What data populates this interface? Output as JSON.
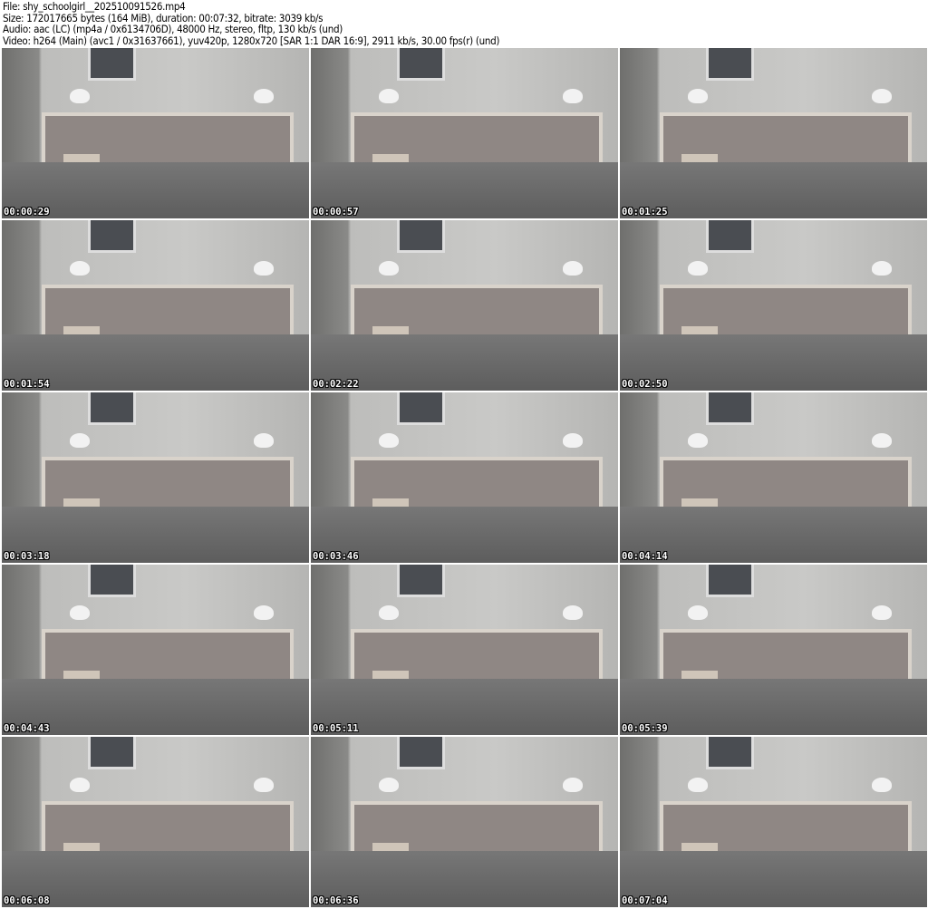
{
  "header": {
    "file": "File: shy_schoolgirl__202510091526.mp4",
    "size": "Size: 172017665 bytes (164 MiB), duration: 00:07:32, bitrate: 3039 kb/s",
    "audio": "Audio: aac (LC) (mp4a / 0x6134706D), 48000 Hz, stereo, fltp, 130 kb/s (und)",
    "video": "Video: h264 (Main) (avc1 / 0x31637661), yuv420p, 1280x720 [SAR 1:1 DAR 16:9], 2911 kb/s, 30.00 fps(r) (und)"
  },
  "thumbnails": [
    {
      "time": "00:00:29"
    },
    {
      "time": "00:00:57"
    },
    {
      "time": "00:01:25"
    },
    {
      "time": "00:01:54"
    },
    {
      "time": "00:02:22"
    },
    {
      "time": "00:02:50"
    },
    {
      "time": "00:03:18"
    },
    {
      "time": "00:03:46"
    },
    {
      "time": "00:04:14"
    },
    {
      "time": "00:04:43"
    },
    {
      "time": "00:05:11"
    },
    {
      "time": "00:05:39"
    },
    {
      "time": "00:06:08"
    },
    {
      "time": "00:06:36"
    },
    {
      "time": "00:07:04"
    }
  ]
}
